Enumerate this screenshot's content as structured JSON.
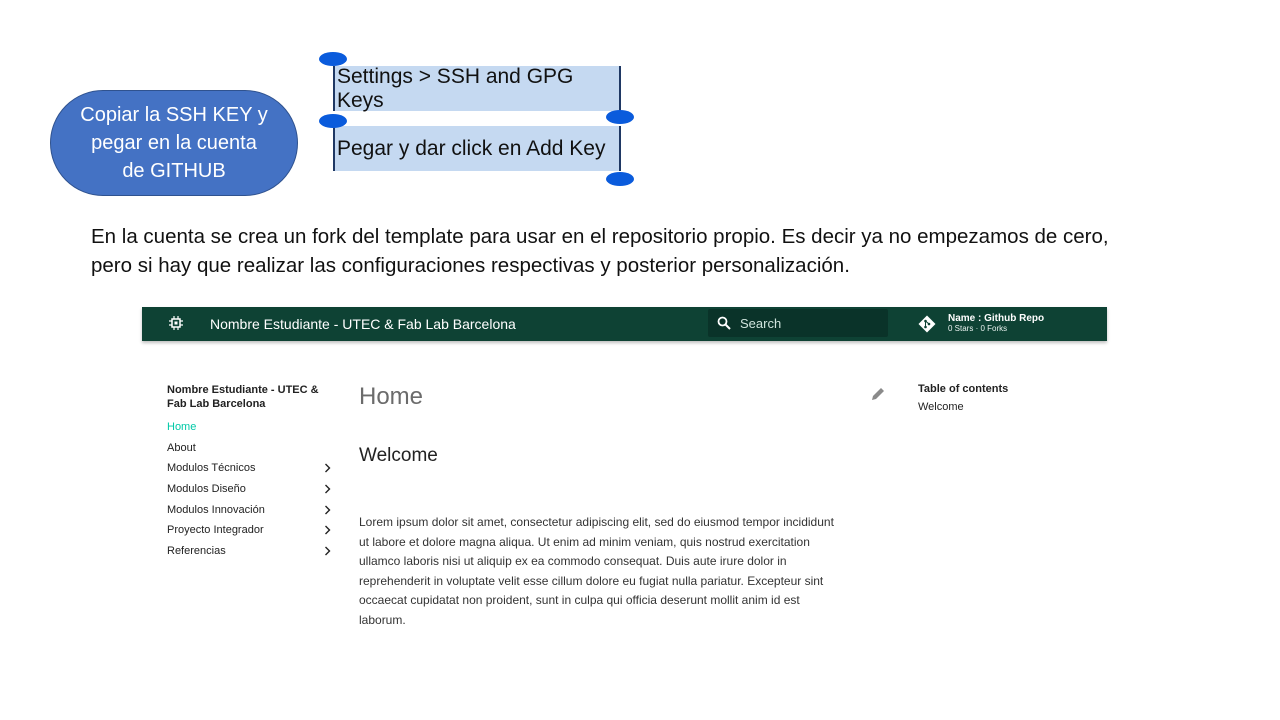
{
  "annotations": {
    "oval_lines": [
      "Copiar la SSH KEY y",
      "pegar en la cuenta",
      "de GITHUB"
    ],
    "step1": "Settings > SSH and GPG Keys",
    "step2": "Pegar y dar click en Add Key",
    "paragraph_lines": [
      "En la cuenta se crea un fork del template para usar en el repositorio propio. Es decir ya no empezamos de cero,",
      "pero si hay que realizar las configuraciones respectivas y posterior personalización."
    ],
    "handle_color": "#0a5bdc"
  },
  "site": {
    "header": {
      "title": "Nombre Estudiante - UTEC & Fab Lab Barcelona",
      "search_placeholder": "Search",
      "repo_name": "Name : Github Repo",
      "repo_facts": "0 Stars · 0 Forks",
      "color": "#0e4234"
    },
    "nav": {
      "title": "Nombre Estudiante - UTEC & Fab Lab Barcelona",
      "items": [
        {
          "label": "Home",
          "active": true,
          "expandable": false
        },
        {
          "label": "About",
          "active": false,
          "expandable": false
        },
        {
          "label": "Modulos Técnicos",
          "active": false,
          "expandable": true
        },
        {
          "label": "Modulos Diseño",
          "active": false,
          "expandable": true
        },
        {
          "label": "Modulos Innovación",
          "active": false,
          "expandable": true
        },
        {
          "label": "Proyecto Integrador",
          "active": false,
          "expandable": true
        },
        {
          "label": "Referencias",
          "active": false,
          "expandable": true
        }
      ],
      "active_color": "#00c9a7"
    },
    "content": {
      "title": "Home",
      "heading": "Welcome",
      "body_lines": [
        "Lorem ipsum dolor sit amet, consectetur adipiscing elit, sed do eiusmod tempor incididunt",
        "ut labore et dolore magna aliqua. Ut enim ad minim veniam, quis nostrud exercitation",
        "ullamco laboris nisi ut aliquip ex ea commodo consequat. Duis aute irure dolor in",
        "reprehenderit in voluptate velit esse cillum dolore eu fugiat nulla pariatur. Excepteur sint",
        "occaecat cupidatat non proident, sunt in culpa qui officia deserunt mollit anim id est",
        "laborum."
      ]
    },
    "toc": {
      "title": "Table of contents",
      "items": [
        "Welcome"
      ]
    }
  }
}
